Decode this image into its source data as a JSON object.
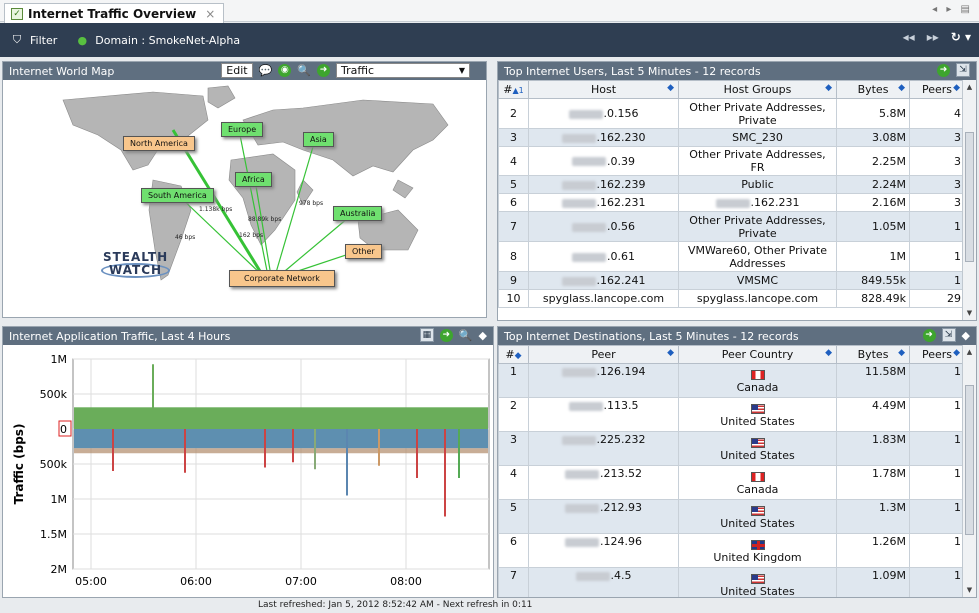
{
  "tab": {
    "title": "Internet Traffic Overview",
    "close": "×"
  },
  "toolbar": {
    "filter_label": "Filter",
    "domain_label": "Domain : SmokeNet-Alpha"
  },
  "map_panel": {
    "title": "Internet World Map",
    "edit_label": "Edit",
    "select_value": "Traffic",
    "regions": [
      "North America",
      "Europe",
      "Asia",
      "Africa",
      "South America",
      "Australia",
      "Other"
    ],
    "center_node": "Corporate Network",
    "bps_labels": [
      "1.138k bps",
      "88.89k bps",
      "978 bps",
      "162 bps",
      "46 bps"
    ],
    "logo_line1": "STEALTH",
    "logo_line2": "WATCH"
  },
  "users_panel": {
    "title": "Top Internet Users, Last 5 Minutes - 12 records",
    "columns": [
      "#",
      "Host",
      "Host Groups",
      "Bytes",
      "Peers"
    ],
    "sort_indicator": "▲1",
    "rows": [
      {
        "n": "2",
        "host": ".0.156",
        "group": "Other Private Addresses, Private",
        "bytes": "5.8M",
        "peers": "4"
      },
      {
        "n": "3",
        "host": ".162.230",
        "group": "SMC_230",
        "bytes": "3.08M",
        "peers": "3"
      },
      {
        "n": "4",
        "host": ".0.39",
        "group": "Other Private Addresses, FR",
        "bytes": "2.25M",
        "peers": "3"
      },
      {
        "n": "5",
        "host": ".162.239",
        "group": "Public",
        "bytes": "2.24M",
        "peers": "3"
      },
      {
        "n": "6",
        "host": ".162.231",
        "group": ".162.231",
        "bytes": "2.16M",
        "peers": "3"
      },
      {
        "n": "7",
        "host": ".0.56",
        "group": "Other Private Addresses, Private",
        "bytes": "1.05M",
        "peers": "1"
      },
      {
        "n": "8",
        "host": ".0.61",
        "group": "VMWare60, Other Private Addresses",
        "bytes": "1M",
        "peers": "1"
      },
      {
        "n": "9",
        "host": ".162.241",
        "group": "VMSMC",
        "bytes": "849.55k",
        "peers": "1"
      },
      {
        "n": "10",
        "host": "spyglass.lancope.com",
        "group": "spyglass.lancope.com",
        "bytes": "828.49k",
        "peers": "29"
      }
    ]
  },
  "app_panel": {
    "title": "Internet Application Traffic, Last 4 Hours",
    "ylabel": "Traffic (bps)",
    "yticks": [
      "1M",
      "500k",
      "0",
      "500k",
      "1M",
      "1.5M",
      "2M"
    ],
    "xticks": [
      "05:00",
      "06:00",
      "07:00",
      "08:00"
    ]
  },
  "dest_panel": {
    "title": "Top Internet Destinations, Last 5 Minutes - 12 records",
    "columns": [
      "#",
      "Peer",
      "Peer Country",
      "Bytes",
      "Peers"
    ],
    "rows": [
      {
        "n": "1",
        "peer": ".126.194",
        "country": "Canada",
        "flag": "ca",
        "bytes": "11.58M",
        "peers": "1"
      },
      {
        "n": "2",
        "peer": ".113.5",
        "country": "United States",
        "flag": "us",
        "bytes": "4.49M",
        "peers": "1"
      },
      {
        "n": "3",
        "peer": ".225.232",
        "country": "United States",
        "flag": "us",
        "bytes": "1.83M",
        "peers": "1"
      },
      {
        "n": "4",
        "peer": ".213.52",
        "country": "Canada",
        "flag": "ca",
        "bytes": "1.78M",
        "peers": "1"
      },
      {
        "n": "5",
        "peer": ".212.93",
        "country": "United States",
        "flag": "us",
        "bytes": "1.3M",
        "peers": "1"
      },
      {
        "n": "6",
        "peer": ".124.96",
        "country": "United Kingdom",
        "flag": "uk",
        "bytes": "1.26M",
        "peers": "1"
      },
      {
        "n": "7",
        "peer": ".4.5",
        "country": "United States",
        "flag": "us",
        "bytes": "1.09M",
        "peers": "1"
      }
    ]
  },
  "status": {
    "text": "Last refreshed: Jan 5, 2012 8:52:42 AM - Next refresh in 0:11"
  },
  "colors": {
    "toolbar": "#2f3e52",
    "panel_header": "#5f6f80",
    "inbound": "#6aad5a",
    "outbound": "#5e8fb0",
    "accent": "#3ea52e"
  }
}
